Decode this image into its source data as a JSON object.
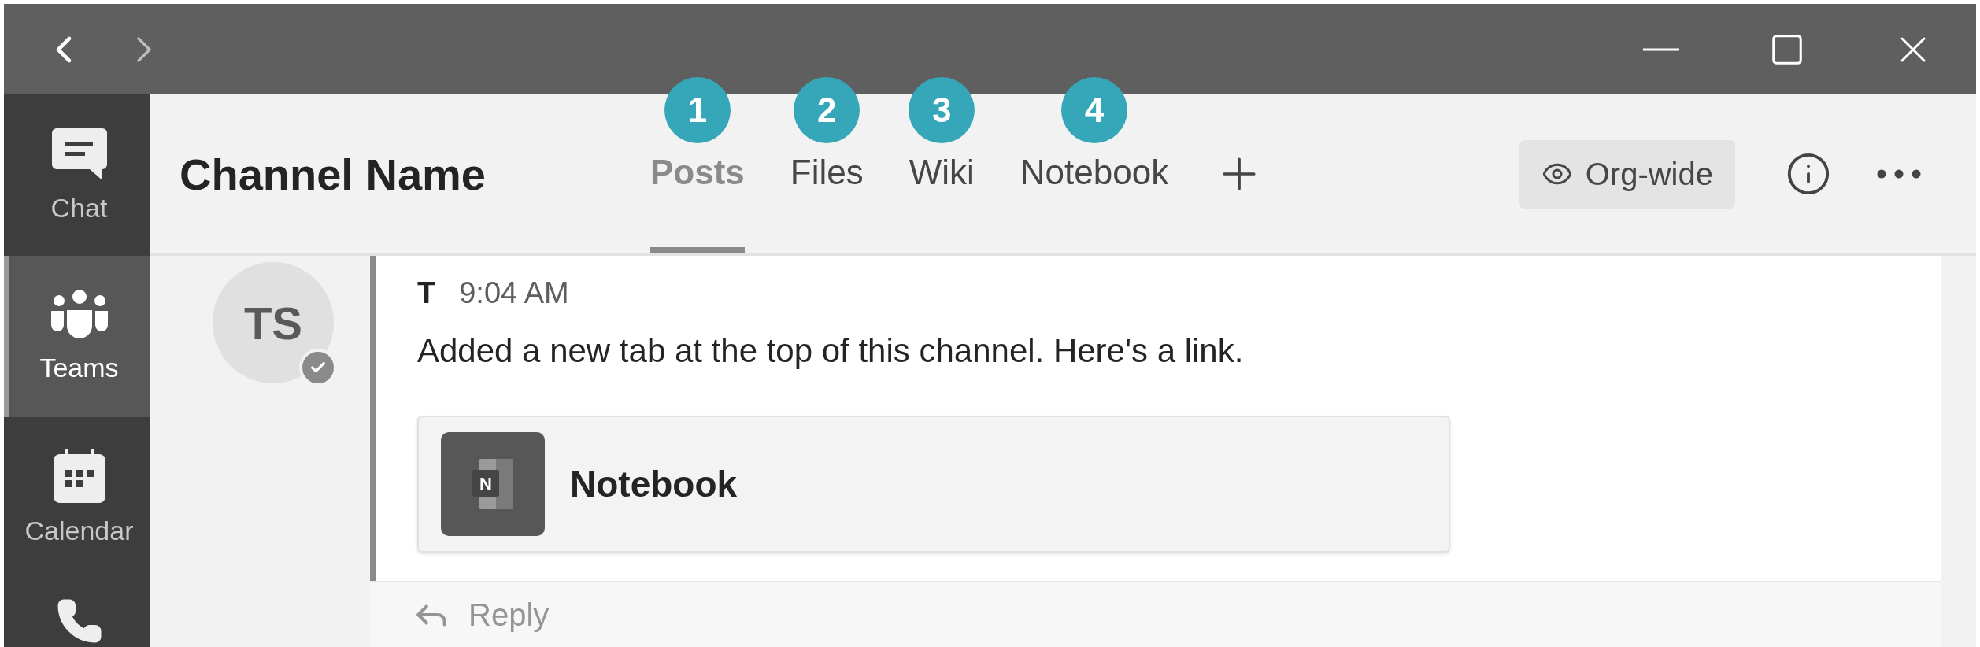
{
  "sidebar": {
    "items": [
      {
        "kind": "chat",
        "label": "Chat",
        "selected": false
      },
      {
        "kind": "teams",
        "label": "Teams",
        "selected": true
      },
      {
        "kind": "calendar",
        "label": "Calendar",
        "selected": false
      },
      {
        "kind": "calls",
        "selected": false
      }
    ]
  },
  "header": {
    "title": "Channel Name",
    "tabs": [
      {
        "label": "Posts",
        "badge": "1",
        "selected": true
      },
      {
        "label": "Files",
        "badge": "2",
        "selected": false
      },
      {
        "label": "Wiki",
        "badge": "3",
        "selected": false
      },
      {
        "label": "Notebook",
        "badge": "4",
        "selected": false
      }
    ],
    "visibility_button": "Org-wide"
  },
  "post": {
    "avatar": {
      "initials": "TS"
    },
    "author": "T",
    "time": "9:04 AM",
    "text": "Added a new tab at the top of this channel. Here's a link.",
    "attachment": {
      "icon_letter": "N",
      "title": "Notebook"
    },
    "reply": "Reply"
  }
}
